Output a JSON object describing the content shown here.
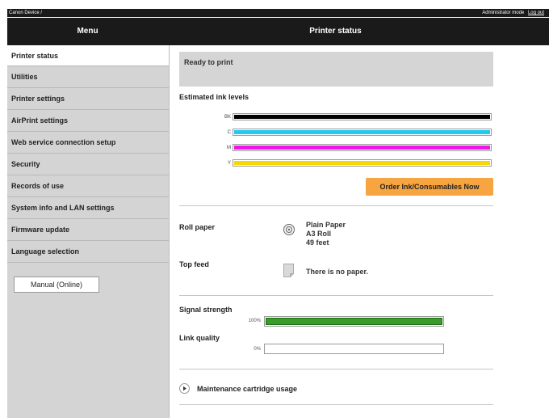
{
  "topbar": {
    "device": "Canon Device /",
    "admin_mode": "Administrator mode",
    "logout": "Log out"
  },
  "header": {
    "menu_title": "Menu",
    "page_title": "Printer status"
  },
  "sidebar": {
    "items": [
      {
        "label": "Printer status"
      },
      {
        "label": "Utilities"
      },
      {
        "label": "Printer settings"
      },
      {
        "label": "AirPrint settings"
      },
      {
        "label": "Web service connection setup"
      },
      {
        "label": "Security"
      },
      {
        "label": "Records of use"
      },
      {
        "label": "System info and LAN settings"
      },
      {
        "label": "Firmware update"
      },
      {
        "label": "Language selection"
      }
    ],
    "manual_button": "Manual (Online)"
  },
  "status": {
    "text": "Ready to print"
  },
  "ink": {
    "heading": "Estimated ink levels",
    "levels": [
      {
        "label": "BK",
        "color": "#000000",
        "level": 1.0
      },
      {
        "label": "C",
        "color": "#23c8ee",
        "level": 1.0
      },
      {
        "label": "M",
        "color": "#ee16e6",
        "level": 1.0
      },
      {
        "label": "Y",
        "color": "#f5d800",
        "level": 1.0
      }
    ],
    "order_button": "Order Ink/Consumables Now",
    "order_button_color": "#f7a540"
  },
  "paper": {
    "roll_label": "Roll paper",
    "roll_lines": [
      "Plain Paper",
      "A3 Roll",
      "49 feet"
    ],
    "topfeed_label": "Top feed",
    "topfeed_text": "There is no paper."
  },
  "network": {
    "signal_label": "Signal strength",
    "signal_pct_text": "100%",
    "signal_level": 1.0,
    "link_label": "Link quality",
    "link_pct_text": "0%",
    "link_level": 0.0,
    "fill_color": "#3a9a2a"
  },
  "maintenance": {
    "label": "Maintenance cartridge usage"
  }
}
